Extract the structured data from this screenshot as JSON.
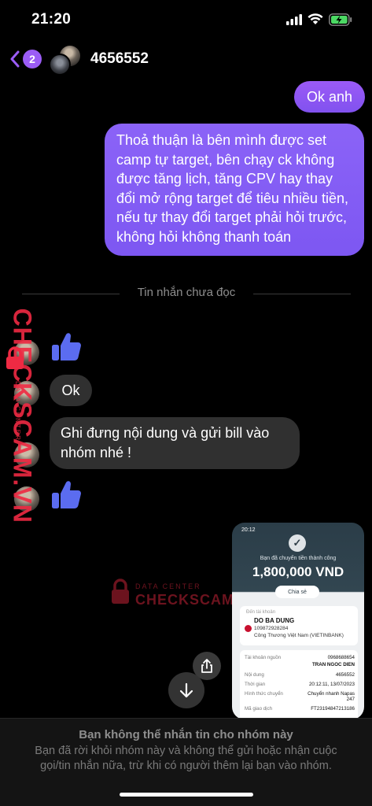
{
  "status_bar": {
    "time": "21:20"
  },
  "header": {
    "back_badge": "2",
    "title": "4656552"
  },
  "messages": {
    "out_1": "Ok anh",
    "out_2": "Thoả thuận là bên mình được set camp tự target, bên chạy ck không được tăng lịch, tăng CPV hay thay đổi mở rộng target để tiêu nhiều tiền, nếu tự thay đổi target phải hỏi trước, không hỏi không thanh toán",
    "unread_divider": "Tin nhắn chưa đọc",
    "in_ok": "Ok",
    "in_note": "Ghi đưng nội dung và gửi bill vào nhóm nhé !"
  },
  "watermark": {
    "vertical": "CHECKSCAM.VN",
    "vertical_sub": "DATA CENTER",
    "center_top": "DATA CENTER",
    "center_text": "CHECKSCAM.VN"
  },
  "receipt": {
    "time": "20:12",
    "success": "Bạn đã chuyển tiền thành công",
    "amount": "1,800,000 VND",
    "share": "Chia sẻ",
    "to_label": "Đến tài khoản",
    "recipient_name": "DO BA DUNG",
    "recipient_account": "109872928284",
    "recipient_bank": "Công Thương Việt Nam (VIETINBANK)",
    "rows": [
      {
        "label": "Tài khoản nguồn",
        "value": "0968688654"
      },
      {
        "label": "",
        "value": "TRAN NGOC DIEN"
      },
      {
        "label": "Nội dung",
        "value": "4656552"
      },
      {
        "label": "Thời gian",
        "value": "20:12:11, 13/07/2023"
      },
      {
        "label": "Hình thức chuyển",
        "value": "Chuyển nhanh Napas 247"
      },
      {
        "label": "Mã giao dịch",
        "value": "FT23194847213186"
      }
    ]
  },
  "notice": {
    "title": "Bạn không thể nhắn tin cho nhóm này",
    "body": "Bạn đã rời khỏi nhóm này và không thể gửi hoặc nhận cuộc gọi/tin nhắn nữa, trừ khi có người thêm lại bạn vào nhóm."
  },
  "colors": {
    "accent": "#9b5cf5",
    "outgoing_bubble": "#8152ef",
    "incoming_bubble": "#303030",
    "thumb": "#5b6cf0",
    "watermark": "#ef2a43"
  }
}
